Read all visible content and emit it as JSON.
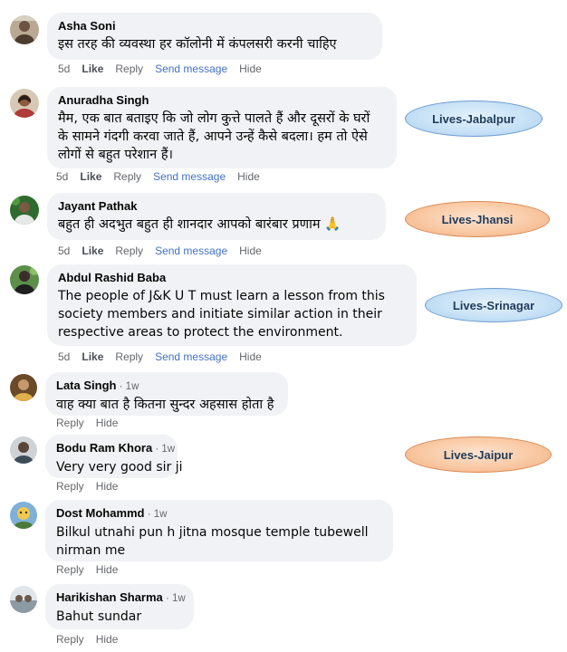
{
  "comments": [
    {
      "author": "Asha Soni",
      "time": "",
      "text": [
        "इस तरह की व्यवस्था हर कॉलोनी में कंपलसरी करनी चाहिए"
      ],
      "actions": {
        "age": "5d",
        "like": "Like",
        "reply": "Reply",
        "send": "Send message",
        "hide": "Hide"
      }
    },
    {
      "author": "Anuradha Singh",
      "time": "",
      "text": [
        "मैम, एक बात बताइए कि जो लोग कुत्ते पालते हैं और दूसरों के घरों",
        "के सामने गंदगी करवा जाते हैं, आपने उन्हें कैसे बदला। हम तो ऐसे",
        "लोगों से बहुत परेशान हैं।"
      ],
      "actions": {
        "age": "5d",
        "like": "Like",
        "reply": "Reply",
        "send": "Send message",
        "hide": "Hide"
      }
    },
    {
      "author": "Jayant Pathak",
      "time": "",
      "text": [
        "बहुत ही अदभुत बहुत ही शानदार आपको बारंबार प्रणाम 🙏"
      ],
      "actions": {
        "age": "5d",
        "like": "Like",
        "reply": "Reply",
        "send": "Send message",
        "hide": "Hide"
      }
    },
    {
      "author": "Abdul Rashid Baba",
      "time": "",
      "text": [
        "The people of J&K U T must learn a lesson from this",
        "society members and initiate similar action in their",
        "respective areas to protect the environment."
      ],
      "actions": {
        "age": "5d",
        "like": "Like",
        "reply": "Reply",
        "send": "Send message",
        "hide": "Hide"
      }
    },
    {
      "author": "Lata Singh",
      "time": " · 1w",
      "text": [
        "वाह क्या बात है कितना सुन्दर अहसास होता है"
      ],
      "actions": {
        "reply": "Reply",
        "hide": "Hide"
      }
    },
    {
      "author": "Bodu Ram Khora",
      "time": " · 1w",
      "text": [
        "Very very good sir ji"
      ],
      "actions": {
        "reply": "Reply",
        "hide": "Hide"
      }
    },
    {
      "author": "Dost Mohammd",
      "time": " · 1w",
      "text": [
        "Bilkul utnahi pun h jitna mosque temple tubewell",
        "nirman me"
      ],
      "actions": {
        "reply": "Reply",
        "hide": "Hide"
      }
    },
    {
      "author": "Harikishan Sharma",
      "time": " · 1w",
      "text": [
        "Bahut sundar"
      ],
      "actions": {
        "reply": "Reply",
        "hide": "Hide"
      }
    }
  ],
  "tags": {
    "jabalpur": "Lives-Jabalpur",
    "jhansi": "Lives-Jhansi",
    "srinagar": "Lives-Srinagar",
    "jaipur": "Lives-Jaipur"
  },
  "colors": {
    "bubble": "#f0f2f5",
    "link": "#4472c4",
    "muted": "#65676b",
    "tag_blue": "#c8e2f6",
    "tag_orange": "#f9c9a4"
  }
}
